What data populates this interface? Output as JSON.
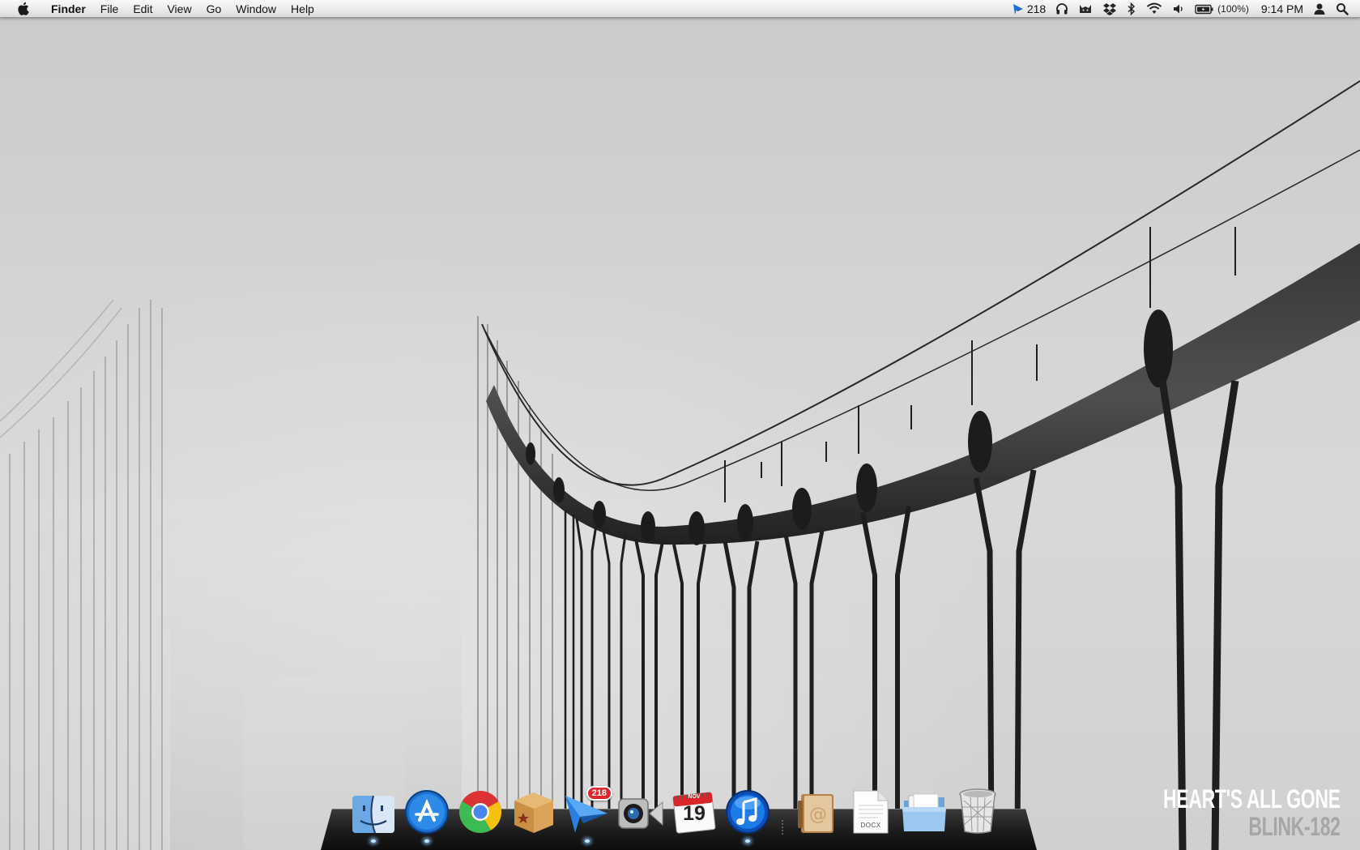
{
  "menubar": {
    "apple_icon": "apple-icon",
    "app_name": "Finder",
    "menus": [
      "File",
      "Edit",
      "View",
      "Go",
      "Window",
      "Help"
    ],
    "status": {
      "mail_count": "218",
      "battery_percent": "(100%)",
      "clock": "9:14 PM",
      "icons": [
        "sparrow-mail-icon",
        "headphones-icon",
        "cat-icon",
        "dropbox-icon",
        "bluetooth-icon",
        "wifi-icon",
        "volume-icon",
        "battery-icon",
        "user-icon",
        "spotlight-icon"
      ]
    }
  },
  "dock": {
    "apps": [
      {
        "name": "Finder",
        "icon": "finder-icon",
        "running": true
      },
      {
        "name": "App Store",
        "icon": "app-store-icon",
        "running": true
      },
      {
        "name": "Google Chrome",
        "icon": "chrome-icon",
        "running": false
      },
      {
        "name": "Delicious Library",
        "icon": "box-star-icon",
        "running": false
      },
      {
        "name": "Sparrow",
        "icon": "sparrow-icon",
        "running": true,
        "badge": "218"
      },
      {
        "name": "FaceTime",
        "icon": "facetime-icon",
        "running": false
      },
      {
        "name": "iCal",
        "icon": "calendar-icon",
        "running": false,
        "month": "NOV",
        "day": "19"
      },
      {
        "name": "iTunes",
        "icon": "itunes-icon",
        "running": true
      }
    ],
    "stacks": [
      {
        "name": "Address Book",
        "icon": "address-book-icon"
      },
      {
        "name": "Document",
        "icon": "docx-icon",
        "label": "DOCX"
      },
      {
        "name": "Folder",
        "icon": "folder-icon"
      },
      {
        "name": "Trash",
        "icon": "trash-icon"
      }
    ]
  },
  "wallpaper": {
    "line1": "HEART'S ALL GONE",
    "line2": "BLINK-182",
    "colors": {
      "sky": "#d4d4d4",
      "cable": "#1a1a1a",
      "line1": "#ffffff",
      "line2": "#a6a6a6"
    }
  }
}
